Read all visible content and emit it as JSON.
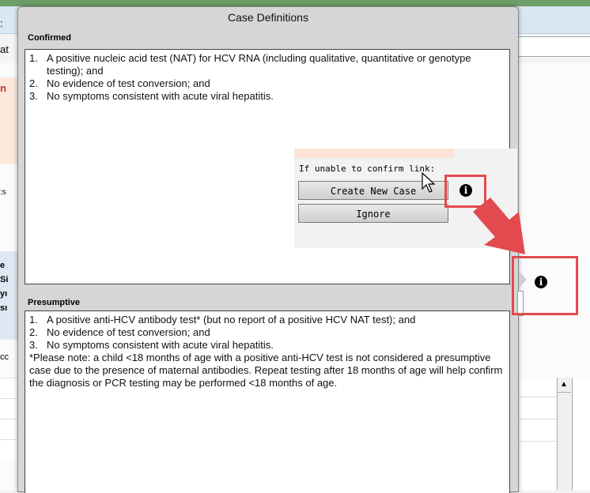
{
  "background": {
    "left_labels": [
      ":",
      "at",
      "n",
      ":s",
      "e",
      "Si",
      "yı",
      "sı",
      "cc"
    ]
  },
  "dialog": {
    "title": "Case Definitions",
    "confirmed": {
      "label": "Confirmed",
      "items": [
        {
          "num": "1.",
          "text": "A positive nucleic acid test (NAT) for HCV RNA (including qualitative, quantitative or genotype testing); and"
        },
        {
          "num": "2.",
          "text": "No evidence of test conversion; and"
        },
        {
          "num": "3.",
          "text": "No symptoms consistent with acute viral hepatitis."
        }
      ]
    },
    "presumptive": {
      "label": "Presumptive",
      "items": [
        {
          "num": "1.",
          "text": "A positive anti-HCV antibody test* (but no report of a positive HCV NAT test); and"
        },
        {
          "num": "2.",
          "text": "No evidence of test conversion; and"
        },
        {
          "num": "3.",
          "text": "No symptoms consistent with acute viral hepatitis."
        }
      ],
      "note": "*Please note: a child <18 months of age with a positive anti-HCV test is not considered a presumptive case due to the presence of maternal antibodies. Repeat testing after 18 months of age will help confirm the diagnosis or PCR testing may be performed <18 months of age."
    }
  },
  "popup": {
    "label": "If unable to confirm link:",
    "create_button": "Create New Case",
    "ignore_button": "Ignore"
  },
  "icons": {
    "info_icon_glyph": "i",
    "highlight_color": "#e24a4f"
  }
}
